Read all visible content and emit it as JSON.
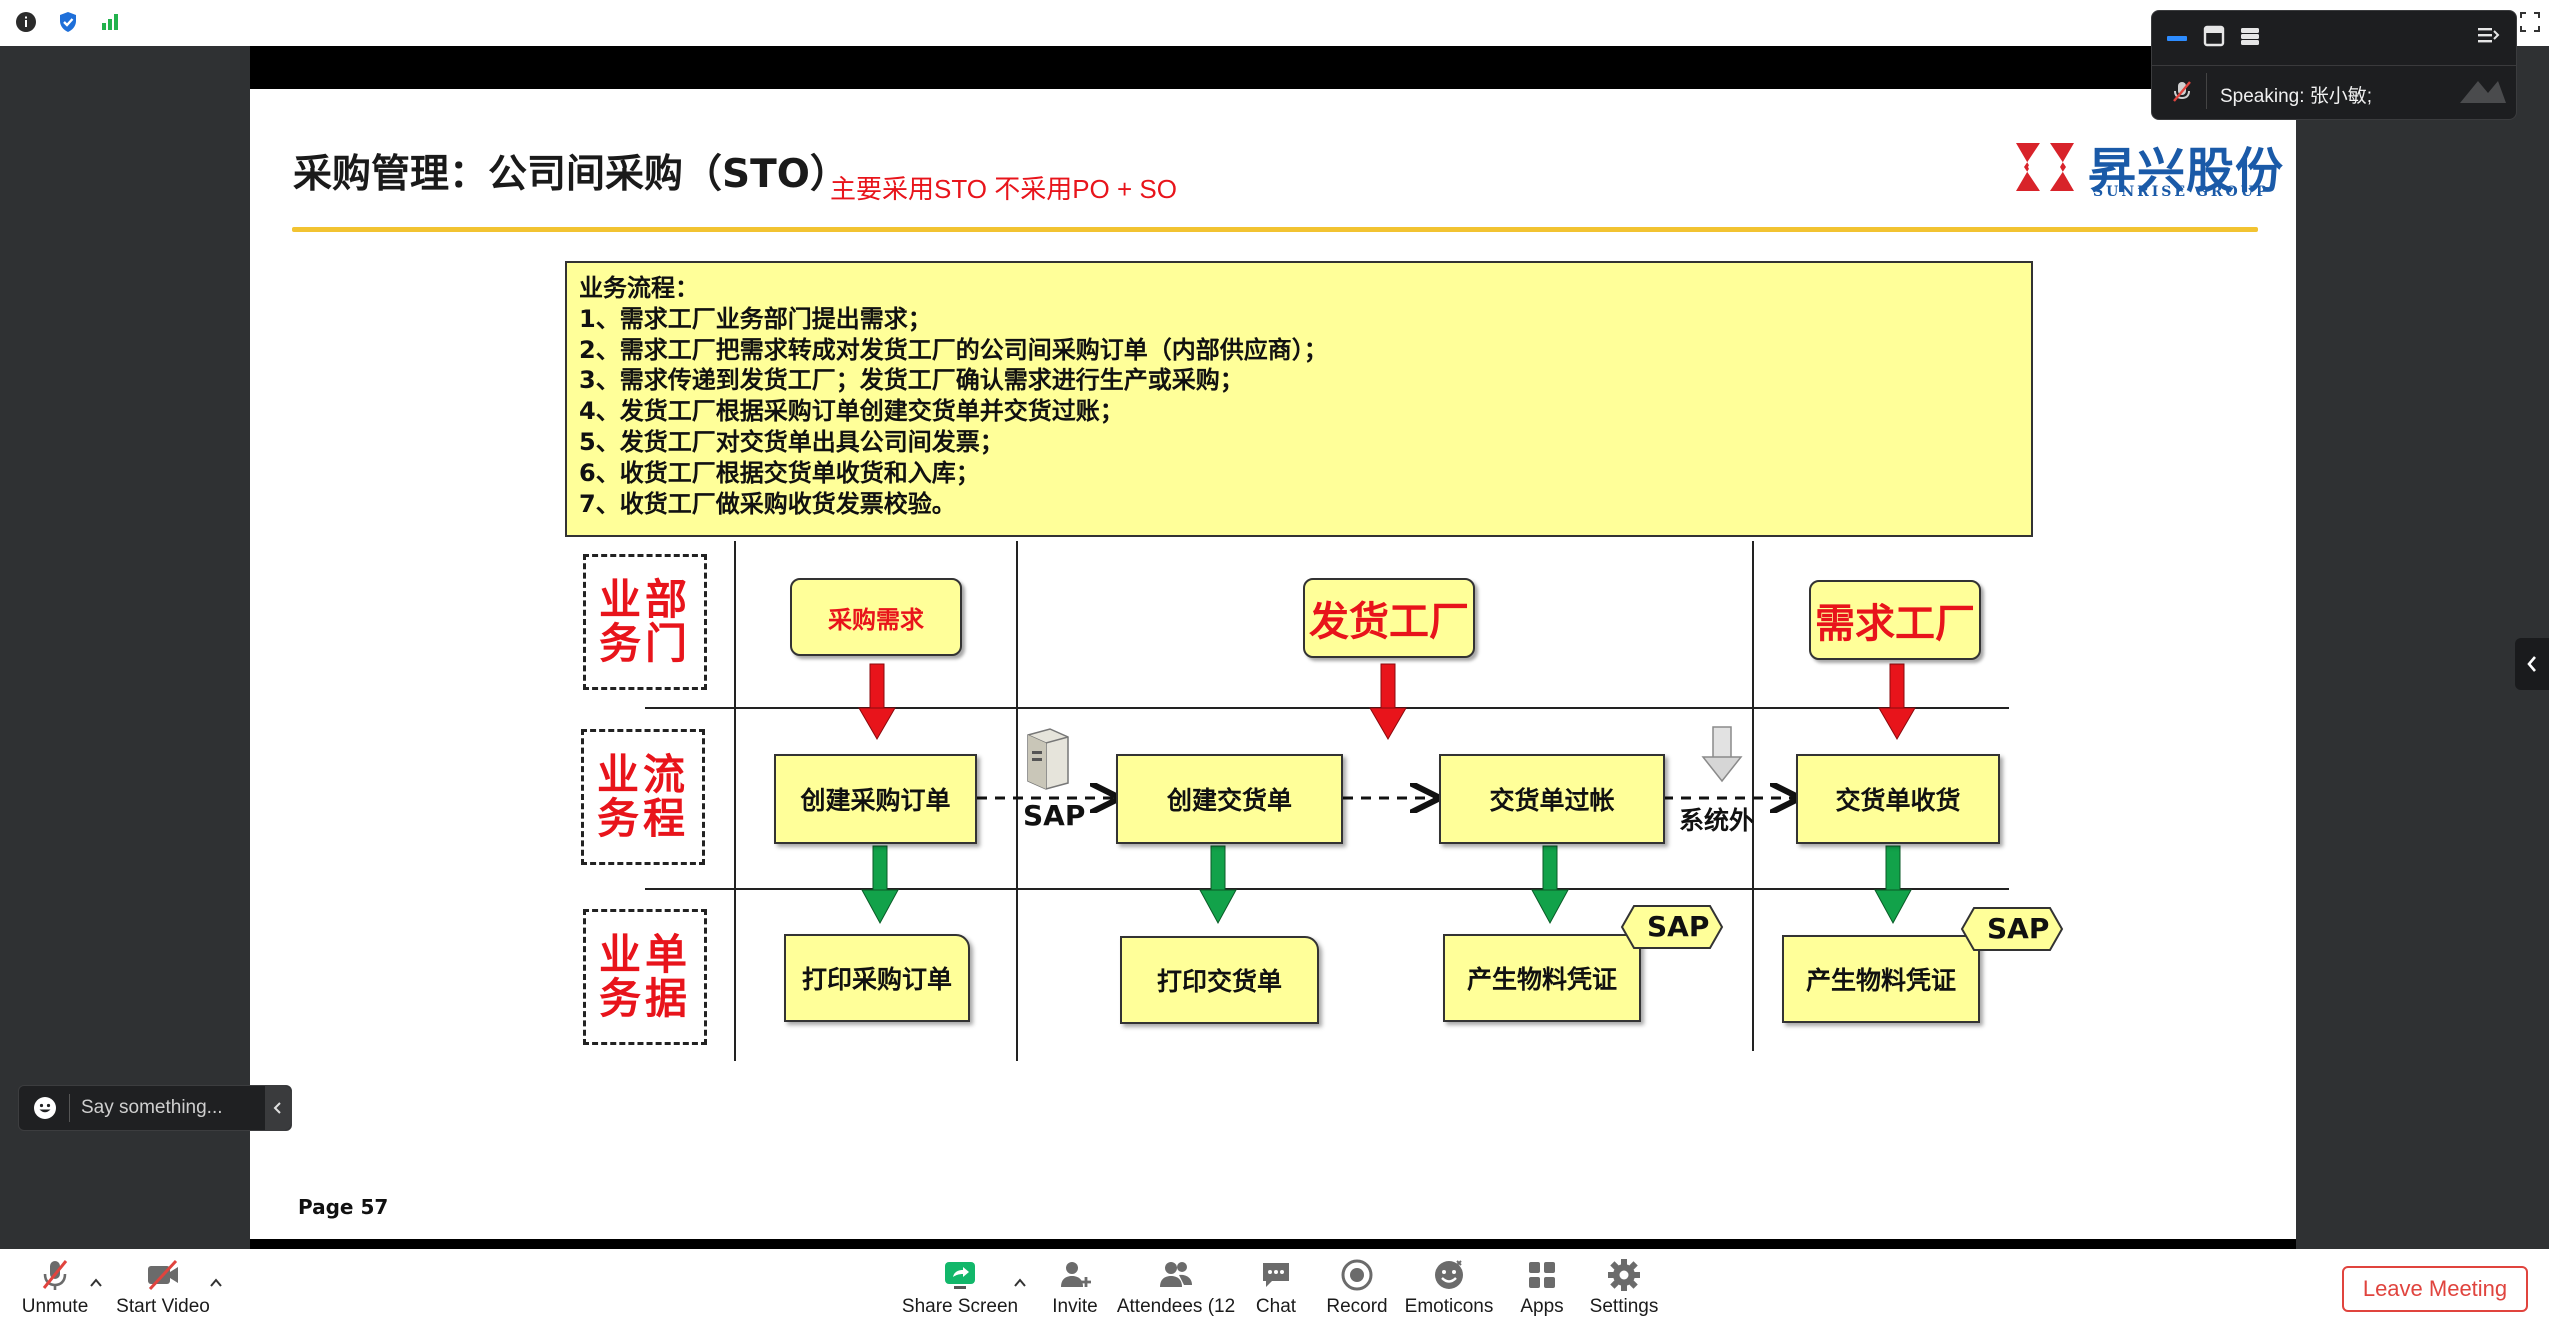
{
  "slide": {
    "title": "采购管理：公司间采购（STO）",
    "note": "主要采用STO  不采用PO + SO",
    "logo_cn": "昇兴股份",
    "logo_en": "SUNRISE GROUP",
    "process_lines": [
      "业务流程：",
      "1、需求工厂业务部门提出需求；",
      "2、需求工厂把需求转成对发货工厂的公司间采购订单（内部供应商）；",
      "3、需求传递到发货工厂；发货工厂确认需求进行生产或采购；",
      "4、发货工厂根据采购订单创建交货单并交货过账；",
      "5、发货工厂对交货单出具公司间发票；",
      "6、收货工厂根据交货单收货和入库；",
      "7、收货工厂做采购收货发票校验。"
    ],
    "lanes": [
      {
        "line1": "业部",
        "line2": "务门"
      },
      {
        "line1": "业流",
        "line2": "务程"
      },
      {
        "line1": "业单",
        "line2": "务据"
      }
    ],
    "nodes": {
      "purchase_req": "采购需求",
      "ship_plant": "发货工厂",
      "demand_plant": "需求工厂",
      "create_po": "创建采购订单",
      "create_delivery": "创建交货单",
      "delivery_post": "交货单过帐",
      "delivery_receipt": "交货单收货",
      "print_po": "打印采购订单",
      "print_delivery": "打印交货单",
      "material_doc_1": "产生物料凭证",
      "material_doc_2": "产生物料凭证"
    },
    "sap_label": "SAP",
    "outside_system": "系统外",
    "sap_tag_1": "SAP",
    "sap_tag_2": "SAP",
    "page": "Page 57"
  },
  "speaking": {
    "text": "Speaking: 张小敏;"
  },
  "chat_input": {
    "placeholder": "Say something..."
  },
  "toolbar": {
    "unmute": "Unmute",
    "start_video": "Start Video",
    "share_screen": "Share Screen",
    "invite": "Invite",
    "attendees": "Attendees (12",
    "chat": "Chat",
    "record": "Record",
    "emoticons": "Emoticons",
    "apps": "Apps",
    "settings": "Settings",
    "leave": "Leave Meeting"
  },
  "colors": {
    "accent_red": "#e8141b",
    "node_fill": "#ffff99",
    "arrow_red": "#e8141b",
    "arrow_green": "#12a24a",
    "brand_blue": "#1a5aa8",
    "leave_red": "#e0443e"
  }
}
